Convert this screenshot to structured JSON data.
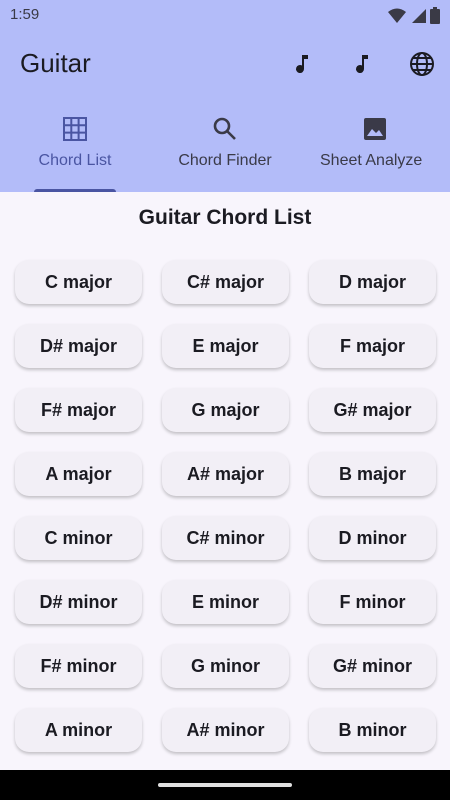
{
  "status": {
    "time": "1:59"
  },
  "app": {
    "title": "Guitar"
  },
  "actions": [
    {
      "icon": "music-note-icon"
    },
    {
      "icon": "music-note-icon"
    },
    {
      "icon": "globe-icon"
    }
  ],
  "tabs": [
    {
      "label": "Chord List",
      "icon": "grid-icon",
      "active": true
    },
    {
      "label": "Chord Finder",
      "icon": "search-icon",
      "active": false
    },
    {
      "label": "Sheet Analyze",
      "icon": "image-icon",
      "active": false
    }
  ],
  "page": {
    "title": "Guitar Chord List"
  },
  "chords": [
    "C major",
    "C# major",
    "D major",
    "D# major",
    "E major",
    "F major",
    "F# major",
    "G major",
    "G# major",
    "A major",
    "A# major",
    "B major",
    "C minor",
    "C# minor",
    "D minor",
    "D# minor",
    "E minor",
    "F minor",
    "F# minor",
    "G minor",
    "G# minor",
    "A minor",
    "A# minor",
    "B minor"
  ],
  "colors": {
    "appbar": "#b3bcf9",
    "accent": "#4a55a2",
    "background": "#f8f5fc",
    "button": "#f2eff6"
  }
}
